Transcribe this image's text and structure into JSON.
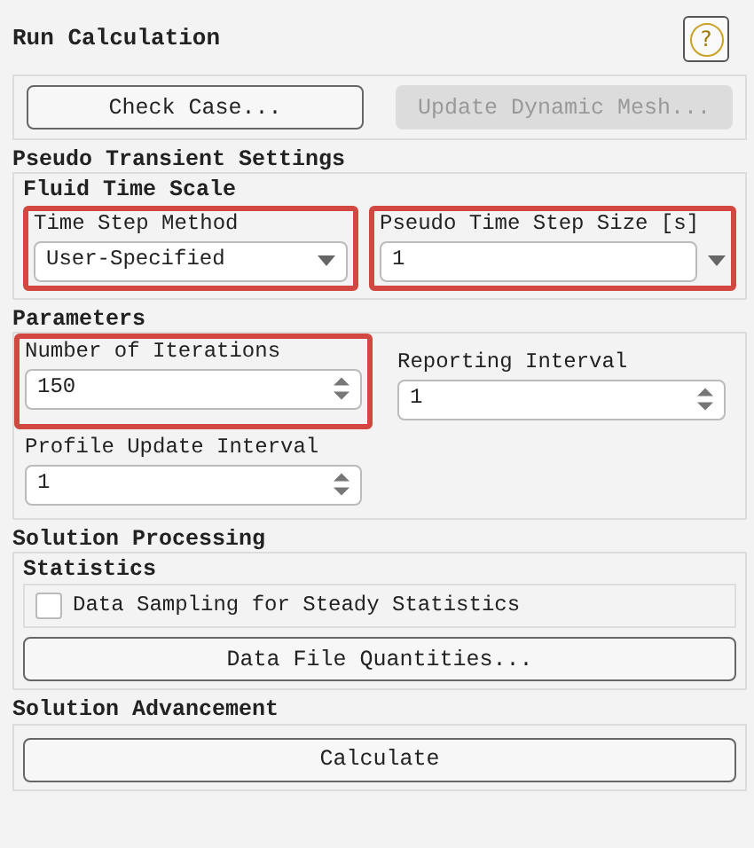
{
  "title": "Run Calculation",
  "help_button": {
    "label": "?"
  },
  "top_buttons": [
    {
      "label": "Check Case...",
      "disabled": false
    },
    {
      "label": "Update Dynamic Mesh...",
      "disabled": true
    }
  ],
  "pseudo_transient": {
    "title": "Pseudo Transient Settings",
    "group_title": "Fluid Time Scale",
    "fields": [
      {
        "kind": "dropdown",
        "label": "Time Step Method",
        "value": "User-Specified",
        "highlighted": true
      },
      {
        "kind": "combo",
        "label": "Pseudo Time Step Size [s]",
        "value": "1",
        "highlighted": true
      }
    ]
  },
  "parameters": {
    "title": "Parameters",
    "fields": [
      {
        "kind": "spinner",
        "label": "Number of Iterations",
        "value": "150",
        "highlighted": true
      },
      {
        "kind": "spinner",
        "label": "Reporting Interval",
        "value": "1",
        "highlighted": false
      },
      {
        "kind": "spinner",
        "label": "Profile Update Interval",
        "value": "1",
        "highlighted": false
      }
    ]
  },
  "solution_processing": {
    "title": "Solution Processing",
    "group_title": "Statistics",
    "checkbox": {
      "label": "Data Sampling for Steady Statistics",
      "checked": false
    },
    "button": {
      "label": "Data File Quantities..."
    }
  },
  "solution_advancement": {
    "title": "Solution Advancement",
    "button": {
      "label": "Calculate"
    }
  }
}
